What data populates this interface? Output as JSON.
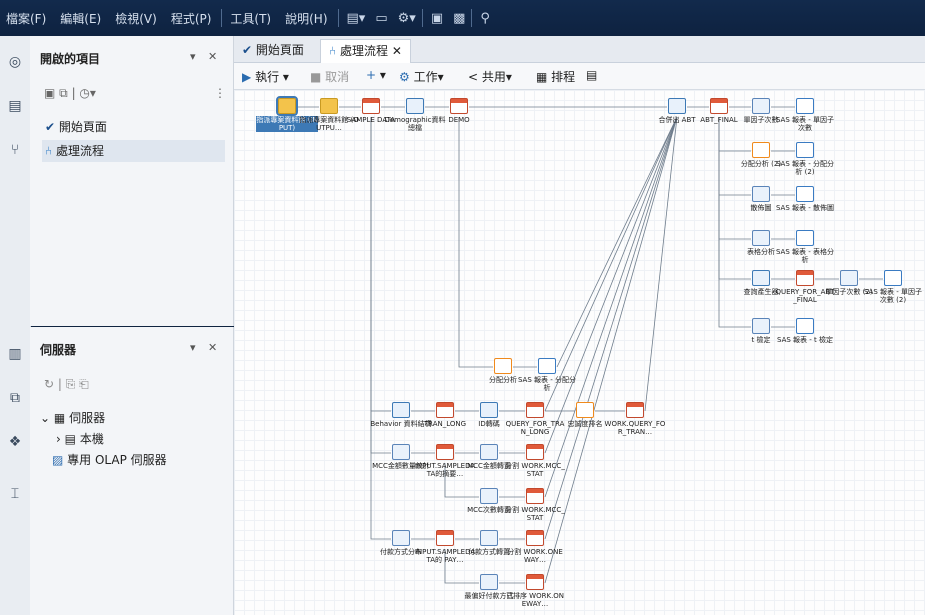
{
  "menubar": {
    "items": [
      "檔案(F)",
      "編輯(E)",
      "檢視(V)",
      "程式(P)",
      "工具(T)",
      "說明(H)"
    ]
  },
  "open_items": {
    "title": "開啟的項目",
    "items": [
      {
        "icon": "rocket-icon",
        "label": "開始頁面"
      },
      {
        "icon": "flow-icon",
        "label": "處理流程"
      }
    ]
  },
  "servers": {
    "title": "伺服器",
    "items": [
      {
        "label": "伺服器"
      },
      {
        "label": "本機"
      },
      {
        "label": "專用 OLAP 伺服器"
      }
    ]
  },
  "tabs": [
    {
      "label": "開始頁面"
    },
    {
      "label": "處理流程"
    }
  ],
  "toolbar": {
    "run": "執行",
    "stop": "取消",
    "job": "工作",
    "share": "共用",
    "schedule": "排程"
  },
  "nodes": [
    {
      "id": "n1",
      "label": "指派專案資料館 (INPUT)",
      "type": "folder",
      "selected": true
    },
    {
      "id": "n2",
      "label": "指派專案資料館 (OUTPU…",
      "type": "folder"
    },
    {
      "id": "n3",
      "label": "SAMPLE DATA",
      "type": "table"
    },
    {
      "id": "n4",
      "label": "Demographic資料總檔",
      "type": "query"
    },
    {
      "id": "n5",
      "label": "DEMO",
      "type": "table"
    },
    {
      "id": "n6",
      "label": "合併出 ABT",
      "type": "query"
    },
    {
      "id": "n7",
      "label": "ABT_FINAL",
      "type": "table"
    },
    {
      "id": "n8",
      "label": "單因子次數",
      "type": "stat"
    },
    {
      "id": "n9",
      "label": "SAS 報表 - 單因子次數",
      "type": "report"
    },
    {
      "id": "n10",
      "label": "分配分析 (2)",
      "type": "chart"
    },
    {
      "id": "n11",
      "label": "SAS 報表 - 分配分析 (2)",
      "type": "report"
    },
    {
      "id": "n12",
      "label": "散佈圖",
      "type": "stat"
    },
    {
      "id": "n13",
      "label": "SAS 報表 - 散佈圖",
      "type": "report"
    },
    {
      "id": "n14",
      "label": "表格分析",
      "type": "stat"
    },
    {
      "id": "n15",
      "label": "SAS 報表 - 表格分析",
      "type": "report"
    },
    {
      "id": "n16",
      "label": "查詢產生器",
      "type": "query"
    },
    {
      "id": "n17",
      "label": "QUERY_FOR_ABT_FINAL",
      "type": "table"
    },
    {
      "id": "n18",
      "label": "單因子次數 (2)",
      "type": "stat"
    },
    {
      "id": "n19",
      "label": "SAS 報表 - 單因子次數 (2)",
      "type": "report"
    },
    {
      "id": "n20",
      "label": "t 檢定",
      "type": "stat"
    },
    {
      "id": "n21",
      "label": "SAS 報表 - t 檢定",
      "type": "report"
    },
    {
      "id": "n22",
      "label": "分配分析",
      "type": "chart"
    },
    {
      "id": "n23",
      "label": "SAS 報表 - 分配分析",
      "type": "report"
    },
    {
      "id": "n24",
      "label": "Behavior 資料結構",
      "type": "query"
    },
    {
      "id": "n25",
      "label": "TRAN_LONG",
      "type": "table"
    },
    {
      "id": "n26",
      "label": "ID轉碼",
      "type": "query"
    },
    {
      "id": "n27",
      "label": "QUERY_FOR_TRAN_LONG",
      "type": "table"
    },
    {
      "id": "n28",
      "label": "忠誠度排名",
      "type": "chart"
    },
    {
      "id": "n29",
      "label": "WORK.QUERY_FOR_TRAN…",
      "type": "table"
    },
    {
      "id": "n30",
      "label": "MCC金額數量統計",
      "type": "stat"
    },
    {
      "id": "n31",
      "label": "INPUT.SAMPLEDATA的摘要…",
      "type": "table"
    },
    {
      "id": "n32",
      "label": "MCC金額轉置",
      "type": "stat"
    },
    {
      "id": "n33",
      "label": "分割 WORK.MCC_STAT",
      "type": "table"
    },
    {
      "id": "n34",
      "label": "MCC次數轉置",
      "type": "stat"
    },
    {
      "id": "n35",
      "label": "分割 WORK.MCC_STAT",
      "type": "table"
    },
    {
      "id": "n36",
      "label": "付款方式分布",
      "type": "stat"
    },
    {
      "id": "n37",
      "label": "INPUT.SAMPLEDATA的 PAY…",
      "type": "table"
    },
    {
      "id": "n38",
      "label": "付款方式轉置",
      "type": "stat"
    },
    {
      "id": "n39",
      "label": "分割 WORK.ONEWAY…",
      "type": "table"
    },
    {
      "id": "n40",
      "label": "最偏好付款方式",
      "type": "stat"
    },
    {
      "id": "n41",
      "label": "已排序 WORK.ONEWAY…",
      "type": "table"
    }
  ]
}
